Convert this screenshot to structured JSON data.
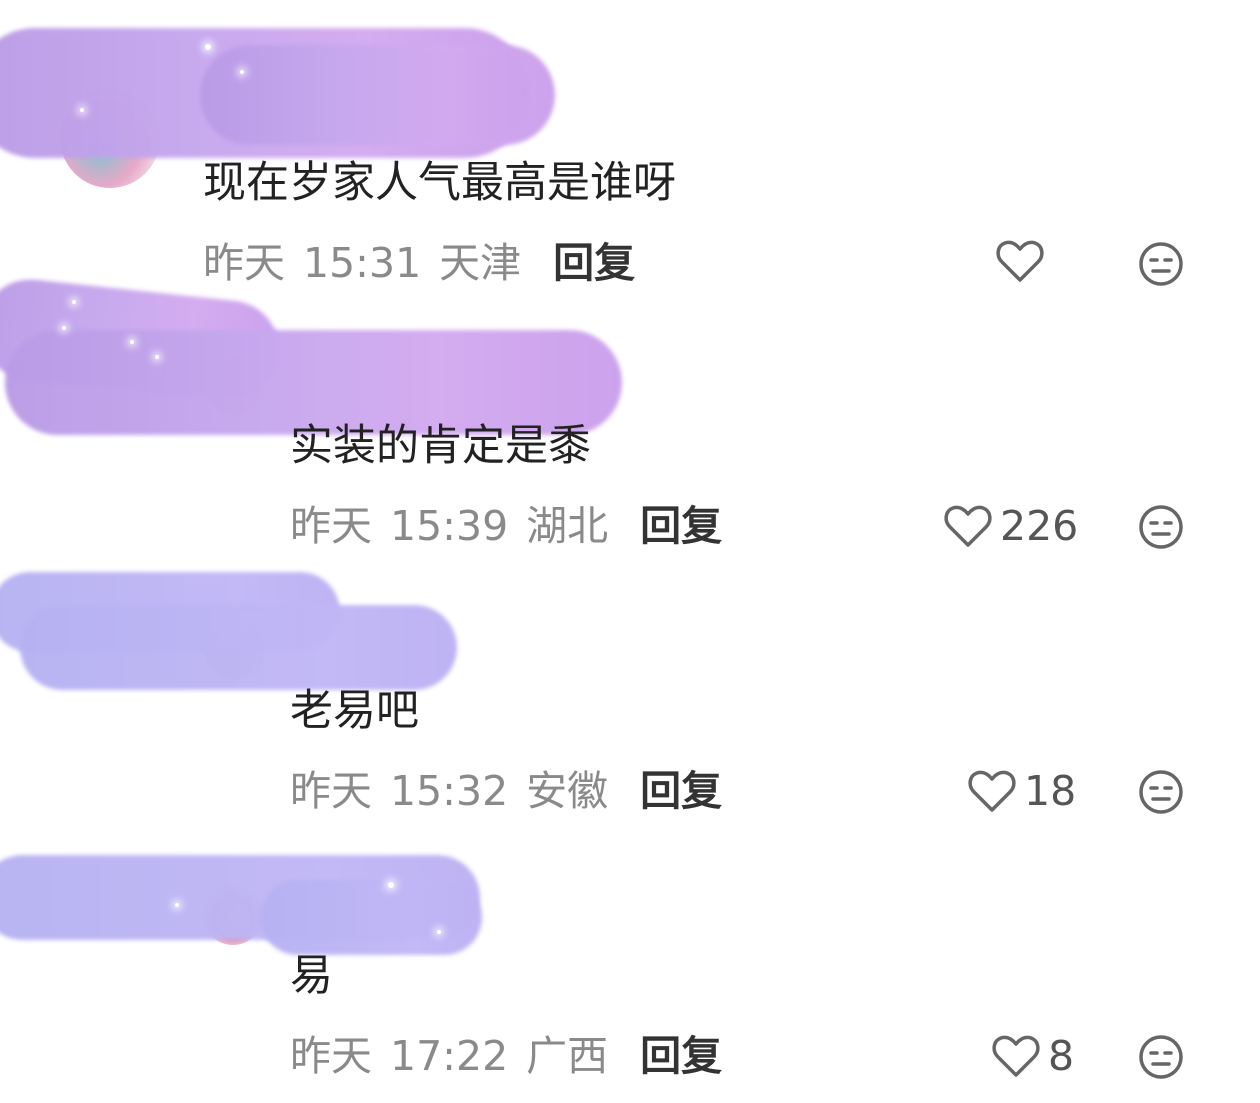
{
  "comments": [
    {
      "text": "现在岁家人气最高是谁呀",
      "date": "昨天",
      "time": "15:31",
      "location": "天津",
      "reply_label": "回复",
      "like_count": "",
      "like_icon": "heart-outline-icon",
      "dislike_icon": "unamused-face-icon"
    },
    {
      "text": "实装的肯定是黍",
      "date": "昨天",
      "time": "15:39",
      "location": "湖北",
      "reply_label": "回复",
      "like_count": "226",
      "like_icon": "heart-outline-icon",
      "dislike_icon": "unamused-face-icon"
    },
    {
      "text": "老易吧",
      "date": "昨天",
      "time": "15:32",
      "location": "安徽",
      "reply_label": "回复",
      "like_count": "18",
      "like_icon": "heart-outline-icon",
      "dislike_icon": "unamused-face-icon"
    },
    {
      "text": "易",
      "date": "昨天",
      "time": "17:22",
      "location": "广西",
      "reply_label": "回复",
      "like_count": "8",
      "like_icon": "heart-outline-icon",
      "dislike_icon": "unamused-face-icon"
    }
  ],
  "colors": {
    "text": "#222222",
    "meta": "#8a8a8a",
    "reply": "#333333",
    "icon": "#666666",
    "mask_purple": "#c6a8ee",
    "mask_blue": "#bcb5f4"
  }
}
